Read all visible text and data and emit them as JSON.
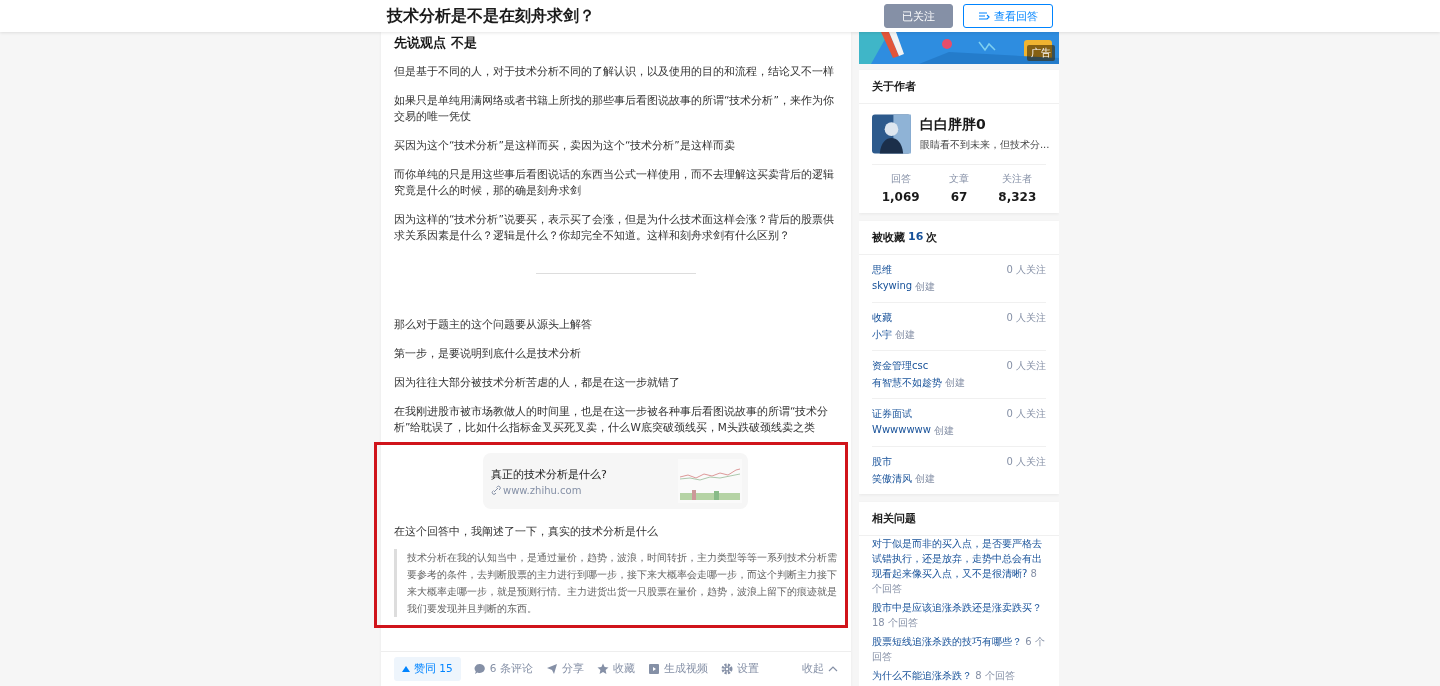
{
  "header": {
    "title": "技术分析是不是在刻舟求剑？",
    "buttons": [
      {
        "kind": "followed",
        "label": "已关注"
      },
      {
        "kind": "outline",
        "label": "查看回答"
      }
    ]
  },
  "answer": {
    "blocks": [
      {
        "kind": "heading",
        "text": "先说观点 不是"
      },
      {
        "kind": "paragraph",
        "text": "但是基于不同的人，对于技术分析不同的了解认识，以及使用的目的和流程，结论又不一样"
      },
      {
        "kind": "paragraph",
        "text": "如果只是单纯用满网络或者书籍上所找的那些事后看图说故事的所谓“技术分析”，来作为你交易的唯一凭仗"
      },
      {
        "kind": "paragraph",
        "text": "买因为这个“技术分析”是这样而买，卖因为这个“技术分析”是这样而卖"
      },
      {
        "kind": "paragraph",
        "text": "而你单纯的只是用这些事后看图说话的东西当公式一样使用，而不去理解这买卖背后的逻辑究竟是什么的时候，那的确是刻舟求剑"
      },
      {
        "kind": "paragraph",
        "text": "因为这样的“技术分析”说要买，表示买了会涨，但是为什么技术面这样会涨？背后的股票供求关系因素是什么？逻辑是什么？你却完全不知道。这样和刻舟求剑有什么区别？"
      },
      {
        "kind": "divider"
      },
      {
        "kind": "paragraph",
        "text": "那么对于题主的这个问题要从源头上解答"
      },
      {
        "kind": "paragraph",
        "text": "第一步，是要说明到底什么是技术分析"
      },
      {
        "kind": "paragraph",
        "text": "因为往往大部分被技术分析苦虐的人，都是在这一步就错了"
      },
      {
        "kind": "paragraph",
        "text": "在我刚进股市被市场教做人的时间里，也是在这一步被各种事后看图说故事的所谓“技术分析”给耽误了，比如什么指标金叉买死叉卖，什么W底突破颈线买，M头跌破颈线卖之类"
      },
      {
        "kind": "highlight",
        "children": [
          {
            "kind": "link_card",
            "title": "真正的技术分析是什么?",
            "url": "www.zhihu.com"
          },
          {
            "kind": "paragraph",
            "text": "在这个回答中，我阐述了一下，真实的技术分析是什么"
          },
          {
            "kind": "quote",
            "text": "技术分析在我的认知当中，是通过量价，趋势，波浪，时间转折，主力类型等等一系列技术分析需要参考的条件，去判断股票的主力进行到哪一步，接下来大概率会走哪一步，而这个判断主力接下来大概率走哪一步，就是预测行情。主力进货出货一只股票在量价，趋势，波浪上留下的痕迹就是我们要发现并且判断的东西。"
          }
        ]
      }
    ]
  },
  "actions": {
    "items": [
      {
        "kind": "vote",
        "label": "赞同 15"
      },
      {
        "kind": "comment",
        "label": "6 条评论"
      },
      {
        "kind": "share",
        "label": "分享"
      },
      {
        "kind": "favorite",
        "label": "收藏"
      },
      {
        "kind": "video",
        "label": "生成视频"
      },
      {
        "kind": "settings",
        "label": "设置"
      }
    ],
    "collapse": "收起"
  },
  "sidebar": {
    "ad": {
      "badge": "广告"
    },
    "author": {
      "heading": "关于作者",
      "name": "白白胖胖0",
      "bio": "眼睛看不到未来，但技术分...",
      "stats": [
        {
          "label": "回答",
          "value": "1,069"
        },
        {
          "label": "文章",
          "value": "67"
        },
        {
          "label": "关注者",
          "value": "8,323"
        }
      ]
    },
    "collections": {
      "heading": "被收藏",
      "count": "16",
      "suffix": "次",
      "items": [
        {
          "name": "思维",
          "creator": "skywing",
          "created": "创建",
          "followers": "0 人关注"
        },
        {
          "name": "收藏",
          "creator": "小宇",
          "created": "创建",
          "followers": "0 人关注"
        },
        {
          "name": "资金管理csc",
          "creator": "有智慧不如趁势",
          "created": "创建",
          "followers": "0 人关注"
        },
        {
          "name": "证券面试",
          "creator": "Wwwwwww",
          "created": "创建",
          "followers": "0 人关注"
        },
        {
          "name": "股市",
          "creator": "笑傲清风",
          "created": "创建",
          "followers": "0 人关注"
        }
      ]
    },
    "related": {
      "heading": "相关问题",
      "items": [
        {
          "title": "对于似是而非的买入点，是否要严格去试错执行，还是放弃，走势中总会有出现看起来像买入点，又不是很清晰?",
          "answers": "8 个回答"
        },
        {
          "title": "股市中是应该追涨杀跌还是涨卖跌买？",
          "answers": "18 个回答"
        },
        {
          "title": "股票短线追涨杀跌的技巧有哪些？",
          "answers": "6 个回答"
        },
        {
          "title": "为什么不能追涨杀跌？",
          "answers": "8 个回答"
        }
      ]
    }
  }
}
